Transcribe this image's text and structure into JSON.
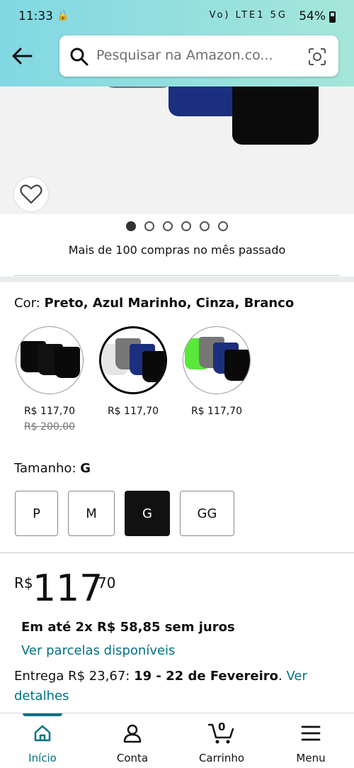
{
  "status_bar": {
    "time": "11:33",
    "signal_text": "Vo) LTE1 5G",
    "battery": "54%"
  },
  "search": {
    "placeholder": "Pesquisar na Amazon.co..."
  },
  "gallery": {
    "dots_count": 6,
    "active_index": 0
  },
  "purchases_note": "Mais de 100 compras no mês passado",
  "color": {
    "label": "Cor:",
    "value": "Preto, Azul Marinho, Cinza, Branco",
    "options": [
      {
        "price": "R$ 117,70",
        "old_price": "R$ 200,00"
      },
      {
        "price": "R$ 117,70",
        "old_price": ""
      },
      {
        "price": "R$ 117,70",
        "old_price": ""
      }
    ],
    "selected_index": 1
  },
  "size": {
    "label": "Tamanho:",
    "value": "G",
    "options": [
      "P",
      "M",
      "G",
      "GG"
    ],
    "selected_index": 2
  },
  "price": {
    "currency": "R$",
    "integer": "117",
    "cents": "70"
  },
  "installments": "Em até 2x R$ 58,85 sem juros",
  "installments_link": "Ver parcelas disponíveis",
  "delivery": {
    "prefix": "Entrega R$ 23,67: ",
    "dates": "19 - 22 de Fevereiro",
    "suffix": ". ",
    "link": "Ver detalhes"
  },
  "nav": {
    "items": [
      "Início",
      "Conta",
      "Carrinho",
      "Menu"
    ],
    "cart_count": "0",
    "active_index": 0
  },
  "colors": {
    "accent": "#007185",
    "header_start": "#82d8e3",
    "header_end": "#a5e6da"
  }
}
